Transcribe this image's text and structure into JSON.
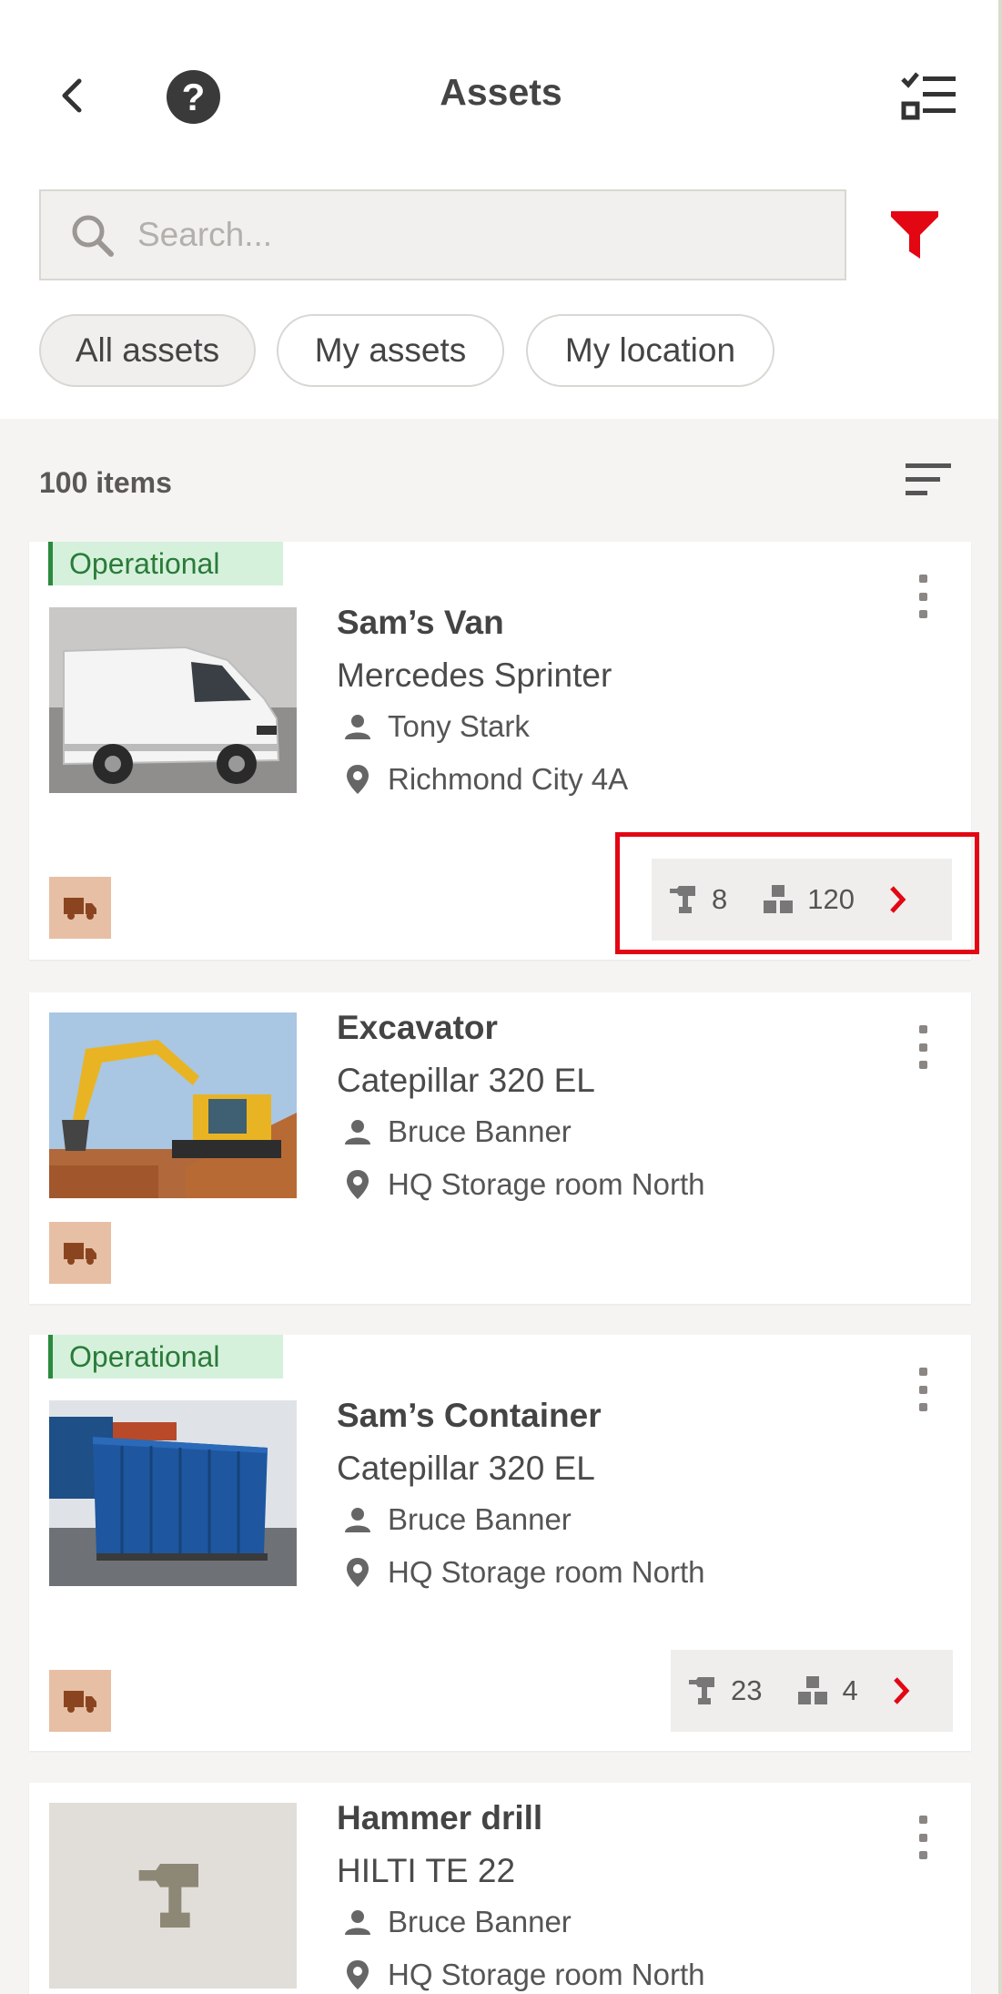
{
  "header": {
    "title": "Assets",
    "back_icon": "chevron-left-icon",
    "help_icon": "help-circle-icon",
    "help_glyph": "?",
    "select_icon": "checklist-icon"
  },
  "search": {
    "placeholder": "Search...",
    "value": "",
    "icon": "search-icon"
  },
  "filter": {
    "icon": "filter-funnel-icon",
    "color": "#e30613"
  },
  "chips": [
    {
      "label": "All assets",
      "selected": true
    },
    {
      "label": "My assets",
      "selected": false
    },
    {
      "label": "My location",
      "selected": false
    }
  ],
  "list": {
    "count_label": "100 items",
    "sort_icon": "sort-icon"
  },
  "assets": [
    {
      "status": "Operational",
      "name": "Sam’s Van",
      "model": "Mercedes Sprinter",
      "owner": "Tony Stark",
      "location": "Richmond City 4A",
      "category_icon": "truck-icon",
      "tools_count": "8",
      "items_count": "120",
      "image": "van-photo"
    },
    {
      "status": "",
      "name": "Excavator",
      "model": "Catepillar 320 EL",
      "owner": "Bruce Banner",
      "location": "HQ Storage room North",
      "category_icon": "truck-icon",
      "image": "excavator-photo"
    },
    {
      "status": "Operational",
      "name": "Sam’s Container",
      "model": "Catepillar 320 EL",
      "owner": "Bruce Banner",
      "location": "HQ Storage room North",
      "category_icon": "truck-icon",
      "tools_count": "23",
      "items_count": "4",
      "image": "container-photo"
    },
    {
      "status": "",
      "name": "Hammer drill",
      "model": "HILTI TE 22",
      "owner": "Bruce Banner",
      "location": "HQ Storage room North",
      "image": "drill-placeholder"
    }
  ],
  "colors": {
    "accent_red": "#e30613",
    "status_green": "#2b8a3e",
    "status_bg": "#d5f1db",
    "badge_bg": "#e7bfa4"
  }
}
